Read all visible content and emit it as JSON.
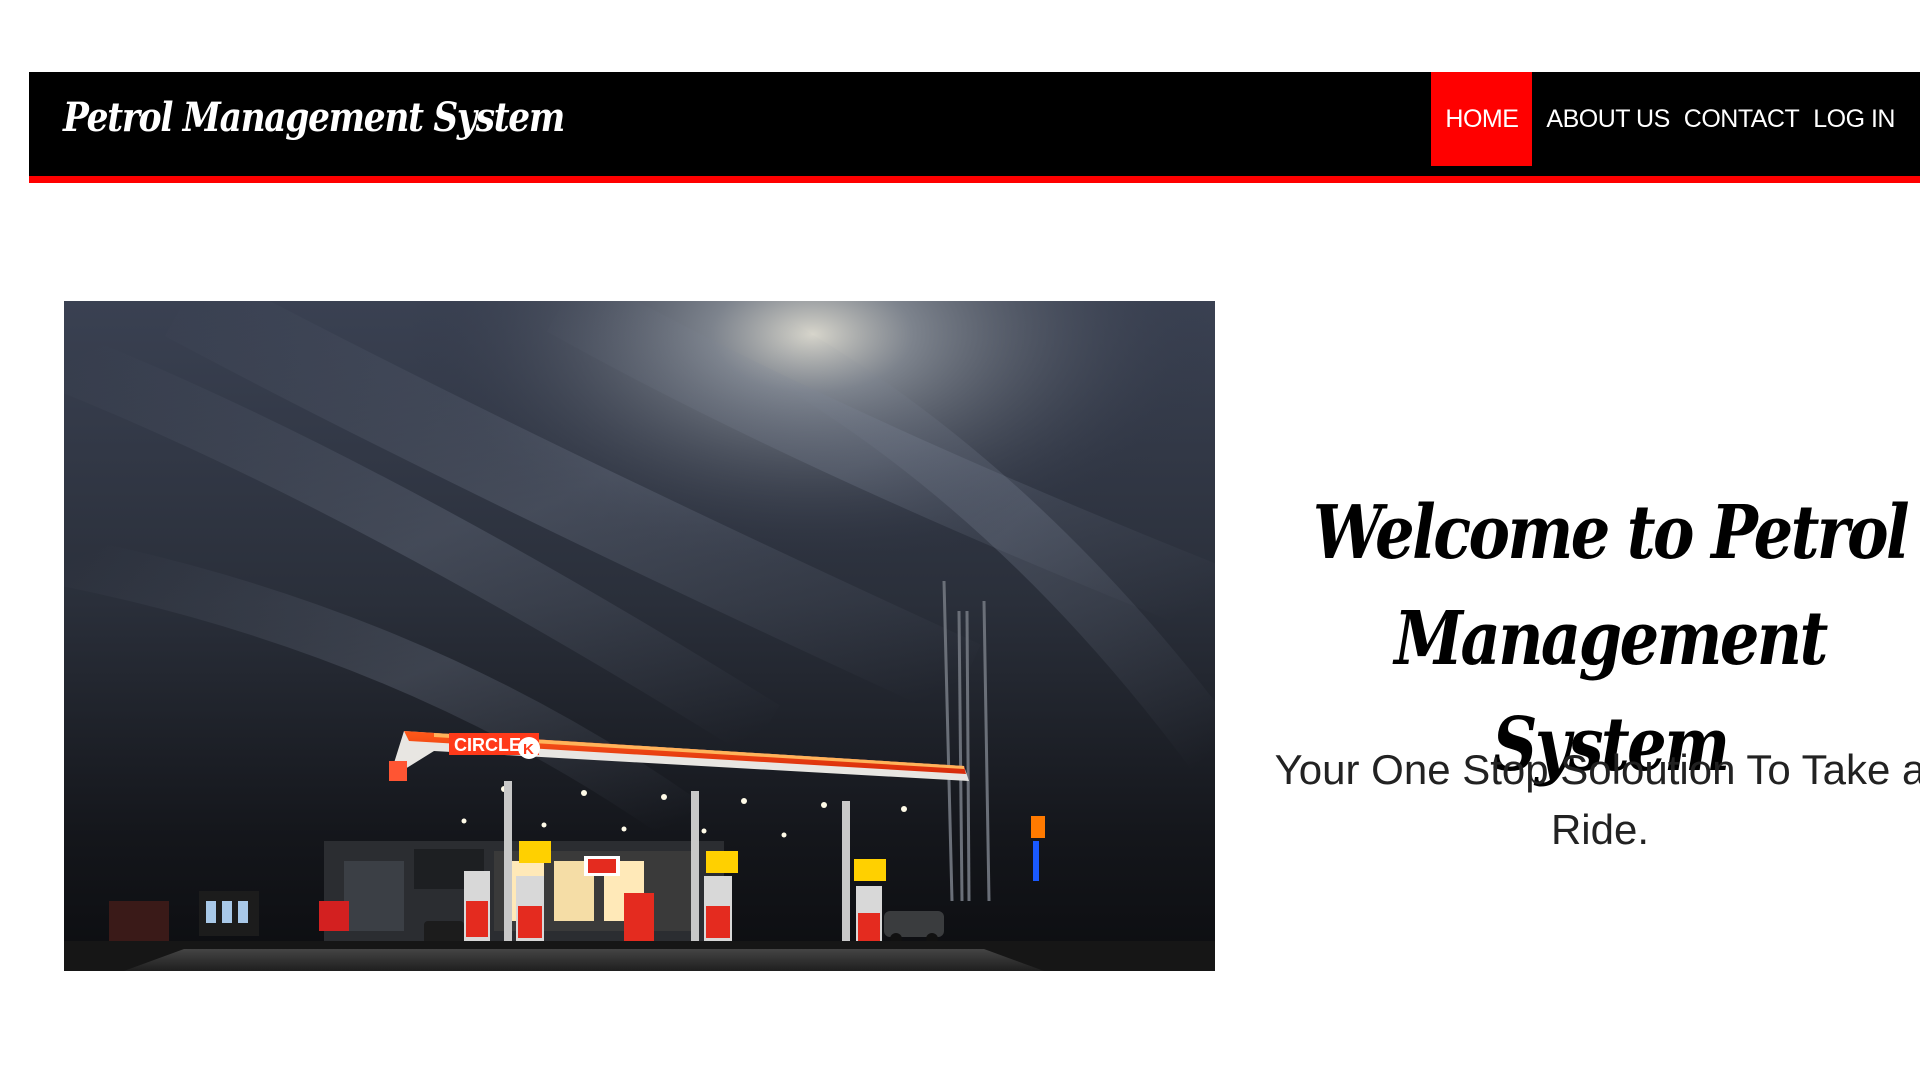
{
  "header": {
    "brand": "Petrol Management System",
    "nav": [
      {
        "label": "HOME",
        "active": true
      },
      {
        "label": "ABOUT US",
        "active": false
      },
      {
        "label": "CONTACT",
        "active": false
      },
      {
        "label": "LOG IN",
        "active": false
      }
    ]
  },
  "hero": {
    "image": "petrol-station-night-photo",
    "canopy_sign": "CIRCLE K"
  },
  "welcome": {
    "title": "Welcome to Petrol Management System",
    "subtitle": "Your One Stop Soloution To Take a Ride."
  },
  "colors": {
    "navbar_bg": "#000000",
    "accent": "#ff0000",
    "text": "#000000",
    "page_bg": "#ffffff"
  }
}
